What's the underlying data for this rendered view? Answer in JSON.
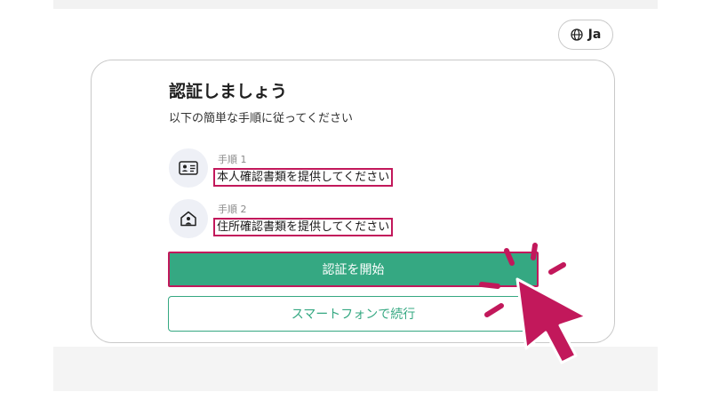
{
  "language_button": {
    "label": "Ja",
    "icon": "globe-icon"
  },
  "card": {
    "title": "認証しましょう",
    "subtitle": "以下の簡単な手順に従ってください",
    "steps": [
      {
        "label": "手順 1",
        "text": "本人確認書類を提供してください",
        "icon": "id-card-icon"
      },
      {
        "label": "手順 2",
        "text": "住所確認書類を提供してください",
        "icon": "house-person-icon"
      }
    ],
    "primary_button": "認証を開始",
    "secondary_button": "スマートフォンで続行"
  },
  "colors": {
    "accent_green": "#35a882",
    "highlight_magenta": "#c2185b",
    "icon_bg": "#eef0f6"
  }
}
